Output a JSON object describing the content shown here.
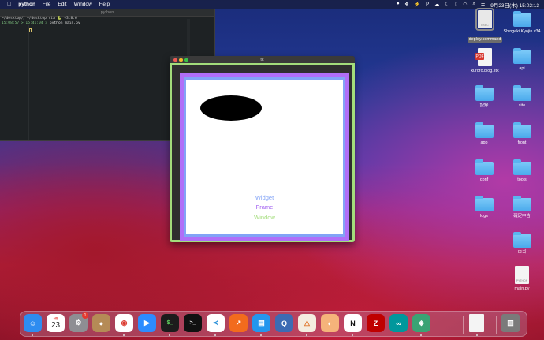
{
  "menubar": {
    "app_name": "python",
    "menus": [
      "File",
      "Edit",
      "Window",
      "Help"
    ],
    "clock": "9月23日(木) 15:02:13",
    "status_icons": [
      "screen-record-icon",
      "dropbox-icon",
      "thunder-icon",
      "cloud-icon",
      "bluetooth-icon",
      "wifi-icon",
      "volume-icon",
      "battery-icon",
      "parking-icon",
      "moon-icon",
      "search-icon",
      "control-center-icon"
    ]
  },
  "terminal": {
    "title": "python",
    "line1": "~/desktop/⧸ ~/desktop via 🐍 v3.8.6",
    "line2_prompt": "15:08:57 > 15:41:04 >",
    "line2_cmd": "python main.py"
  },
  "tk_window": {
    "title": "tk",
    "labels": {
      "widget": "Widget",
      "frame": "Frame",
      "window": "Window"
    },
    "colors": {
      "window": "#a3dd7b",
      "frame": "#b06ef8",
      "widget": "#82a3f6",
      "canvas": "#ffffff",
      "oval": "#000000"
    }
  },
  "desktop": {
    "icons": [
      {
        "name": "deploy.command",
        "kind": "doc",
        "selected": true,
        "doc_label": "EXEC"
      },
      {
        "name": "Shingeki Kyojin v34",
        "kind": "folder"
      },
      {
        "name": "kuroro.blog.stk",
        "kind": "doc",
        "badge": "PDF"
      },
      {
        "name": "api",
        "kind": "folder"
      },
      {
        "name": "記録",
        "kind": "folder"
      },
      {
        "name": "site",
        "kind": "folder"
      },
      {
        "name": "app",
        "kind": "folder"
      },
      {
        "name": "front",
        "kind": "folder"
      },
      {
        "name": "conf",
        "kind": "folder"
      },
      {
        "name": "tools",
        "kind": "folder"
      },
      {
        "name": "logs",
        "kind": "folder"
      },
      {
        "name": "確定申告",
        "kind": "folder"
      },
      {
        "name": "ロゴ",
        "kind": "folder"
      },
      {
        "name": "main.py",
        "kind": "doc",
        "doc_label": "PYTHON"
      }
    ]
  },
  "dock": {
    "calendar": {
      "month": "9月",
      "day": "23"
    },
    "settings_badge": "1",
    "apps": [
      {
        "name": "finder",
        "label": "☺",
        "color": "#2e8cf0"
      },
      {
        "name": "calendar",
        "label": "",
        "color": "#ffffff"
      },
      {
        "name": "system-preferences",
        "label": "⚙",
        "color": "#8e8e93"
      },
      {
        "name": "contacts",
        "label": "●",
        "color": "#b58b56"
      },
      {
        "name": "chrome",
        "label": "◉",
        "color": "#ffffff"
      },
      {
        "name": "zoom",
        "label": "▶",
        "color": "#2d8cff"
      },
      {
        "name": "iterm",
        "label": "$_",
        "color": "#1c1c1c"
      },
      {
        "name": "terminal",
        "label": ">_",
        "color": "#111111"
      },
      {
        "name": "vscode",
        "label": "≺",
        "color": "#ffffff"
      },
      {
        "name": "activity",
        "label": "↗",
        "color": "#f26b1d"
      },
      {
        "name": "docker",
        "label": "▤",
        "color": "#2396ed"
      },
      {
        "name": "quicktime",
        "label": "Q",
        "color": "#3d6bb3"
      },
      {
        "name": "sourcetree",
        "label": "△",
        "color": "#f4ede0"
      },
      {
        "name": "preview",
        "label": "◐",
        "color": "#f5b37a"
      },
      {
        "name": "notion",
        "label": "N",
        "color": "#ffffff"
      },
      {
        "name": "filezilla",
        "label": "Z",
        "color": "#bf0000"
      },
      {
        "name": "arduino",
        "label": "∞",
        "color": "#00979c"
      },
      {
        "name": "app-green",
        "label": "◈",
        "color": "#3aa374"
      },
      {
        "name": "document",
        "label": "",
        "color": "#f4f4f4"
      },
      {
        "name": "trash",
        "label": "▥",
        "color": "#7a7a7a"
      }
    ]
  }
}
